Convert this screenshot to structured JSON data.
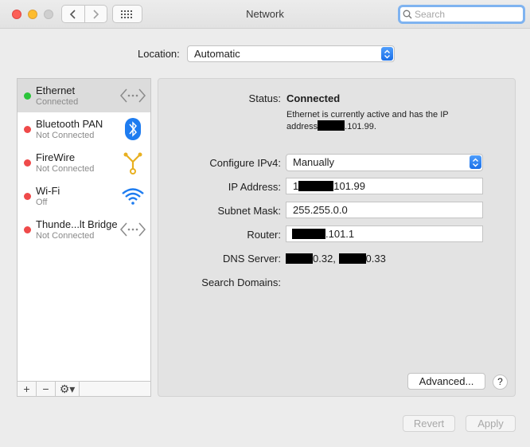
{
  "window": {
    "title": "Network"
  },
  "search": {
    "placeholder": "Search",
    "value": ""
  },
  "location": {
    "label": "Location:",
    "value": "Automatic"
  },
  "services": [
    {
      "name": "Ethernet",
      "status": "Connected",
      "status_color": "#2bc43a",
      "icon": "ethernet-arrows-icon"
    },
    {
      "name": "Bluetooth PAN",
      "status": "Not Connected",
      "status_color": "#ef4a4a",
      "icon": "bluetooth-icon"
    },
    {
      "name": "FireWire",
      "status": "Not Connected",
      "status_color": "#ef4a4a",
      "icon": "firewire-icon"
    },
    {
      "name": "Wi-Fi",
      "status": "Off",
      "status_color": "#ef4a4a",
      "icon": "wifi-icon"
    },
    {
      "name": "Thunde...lt Bridge",
      "status": "Not Connected",
      "status_color": "#ef4a4a",
      "icon": "ethernet-arrows-icon"
    }
  ],
  "toolbar": {
    "add_label": "+",
    "remove_label": "−",
    "gear_label": "⚙▾"
  },
  "detail": {
    "status_label": "Status:",
    "status_value": "Connected",
    "status_desc_pre": "Ethernet is currently active and has the IP address",
    "status_desc_post": ".101.99.",
    "configure_label": "Configure IPv4:",
    "configure_value": "Manually",
    "ip_label": "IP Address:",
    "ip_value_pre": "1",
    "ip_value_post": "101.99",
    "subnet_label": "Subnet Mask:",
    "subnet_value": "255.255.0.0",
    "router_label": "Router:",
    "router_value_post": ".101.1",
    "dns_label": "DNS Server:",
    "dns_value_1": "0.32,",
    "dns_value_2": "0.33",
    "search_domains_label": "Search Domains:"
  },
  "buttons": {
    "advanced": "Advanced...",
    "help": "?",
    "revert": "Revert",
    "apply": "Apply"
  },
  "colors": {
    "accent": "#1a6fe8",
    "connected": "#2bc43a",
    "disconnected": "#ef4a4a"
  }
}
